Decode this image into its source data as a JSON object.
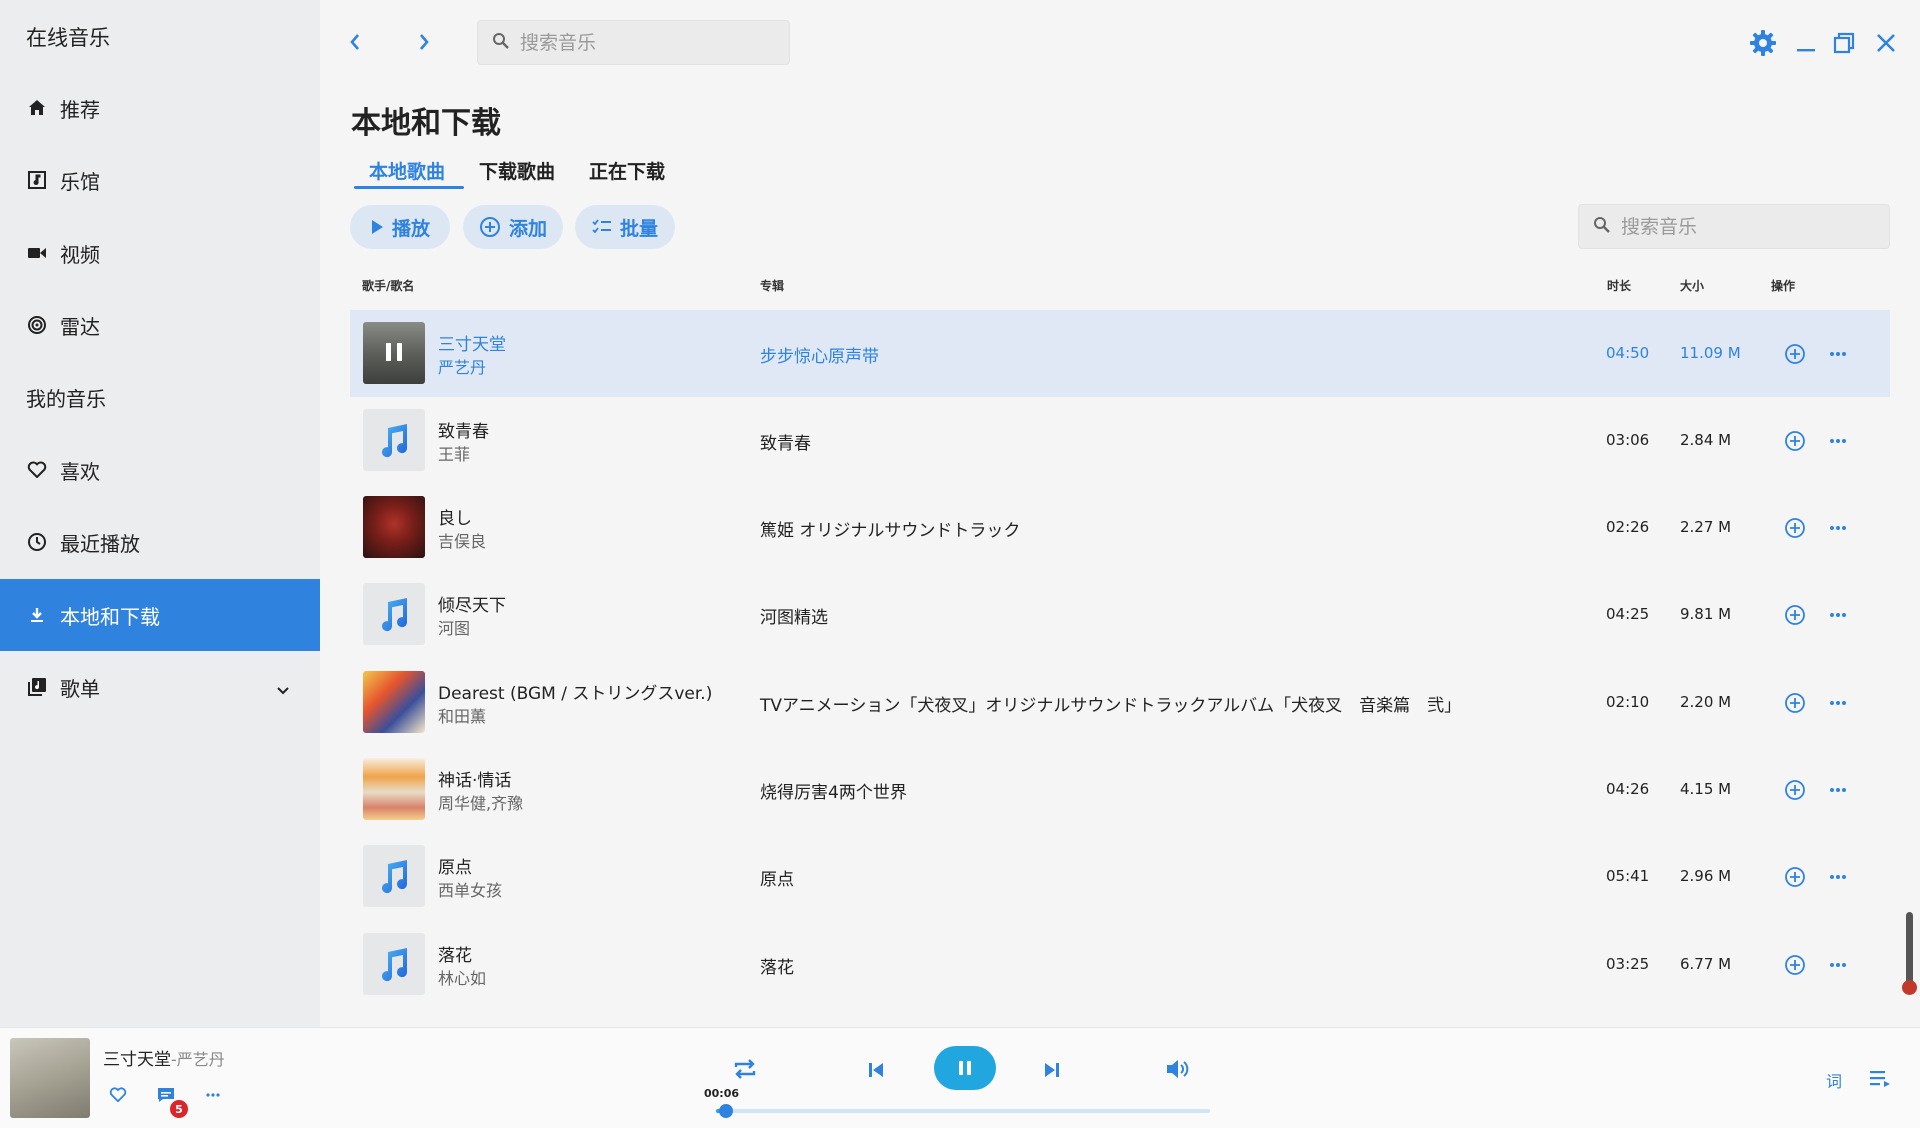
{
  "sidebar": {
    "brand": "在线音乐",
    "items": [
      {
        "label": "推荐"
      },
      {
        "label": "乐馆"
      },
      {
        "label": "视频"
      },
      {
        "label": "雷达"
      },
      {
        "label": "我的音乐"
      },
      {
        "label": "喜欢"
      },
      {
        "label": "最近播放"
      },
      {
        "label": "本地和下载"
      },
      {
        "label": "歌单"
      }
    ]
  },
  "topbar": {
    "search_placeholder": "搜索音乐"
  },
  "page": {
    "title": "本地和下载",
    "tabs": [
      {
        "label": "本地歌曲"
      },
      {
        "label": "下载歌曲"
      },
      {
        "label": "正在下载"
      }
    ],
    "buttons": {
      "play": "播放",
      "add": "添加",
      "batch": "批量"
    },
    "search_placeholder": "搜索音乐"
  },
  "table": {
    "headers": {
      "song": "歌手/歌名",
      "album": "专辑",
      "duration": "时长",
      "size": "大小",
      "actions": "操作"
    },
    "rows": [
      {
        "title": "三寸天堂",
        "artist": "严艺丹",
        "album": "步步惊心原声带",
        "duration": "04:50",
        "size": "11.09 M"
      },
      {
        "title": "致青春",
        "artist": "王菲",
        "album": "致青春",
        "duration": "03:06",
        "size": "2.84 M"
      },
      {
        "title": "良し",
        "artist": "吉俣良",
        "album": "篤姫 オリジナルサウンドトラック",
        "duration": "02:26",
        "size": "2.27 M"
      },
      {
        "title": "倾尽天下",
        "artist": "河图",
        "album": "河图精选",
        "duration": "04:25",
        "size": "9.81 M"
      },
      {
        "title": "Dearest (BGM / ストリングスver.)",
        "artist": "和田薫",
        "album": "TVアニメーション「犬夜叉」オリジナルサウンドトラックアルバム「犬夜叉　音楽篇　弐」",
        "duration": "02:10",
        "size": "2.20 M"
      },
      {
        "title": "神话·情话",
        "artist": "周华健,齐豫",
        "album": "烧得厉害4两个世界",
        "duration": "04:26",
        "size": "4.15 M"
      },
      {
        "title": "原点",
        "artist": "西单女孩",
        "album": "原点",
        "duration": "05:41",
        "size": "2.96 M"
      },
      {
        "title": "落花",
        "artist": "林心如",
        "album": "落花",
        "duration": "03:25",
        "size": "6.77 M"
      }
    ]
  },
  "player": {
    "title": "三寸天堂",
    "artist": "-严艺丹",
    "comment_count": "5",
    "time": "00:06",
    "progress": 0.02,
    "lyric_label": "词"
  },
  "colors": {
    "accent": "#2f83de",
    "play_button": "#22a6e0",
    "badge": "#d9262c"
  }
}
